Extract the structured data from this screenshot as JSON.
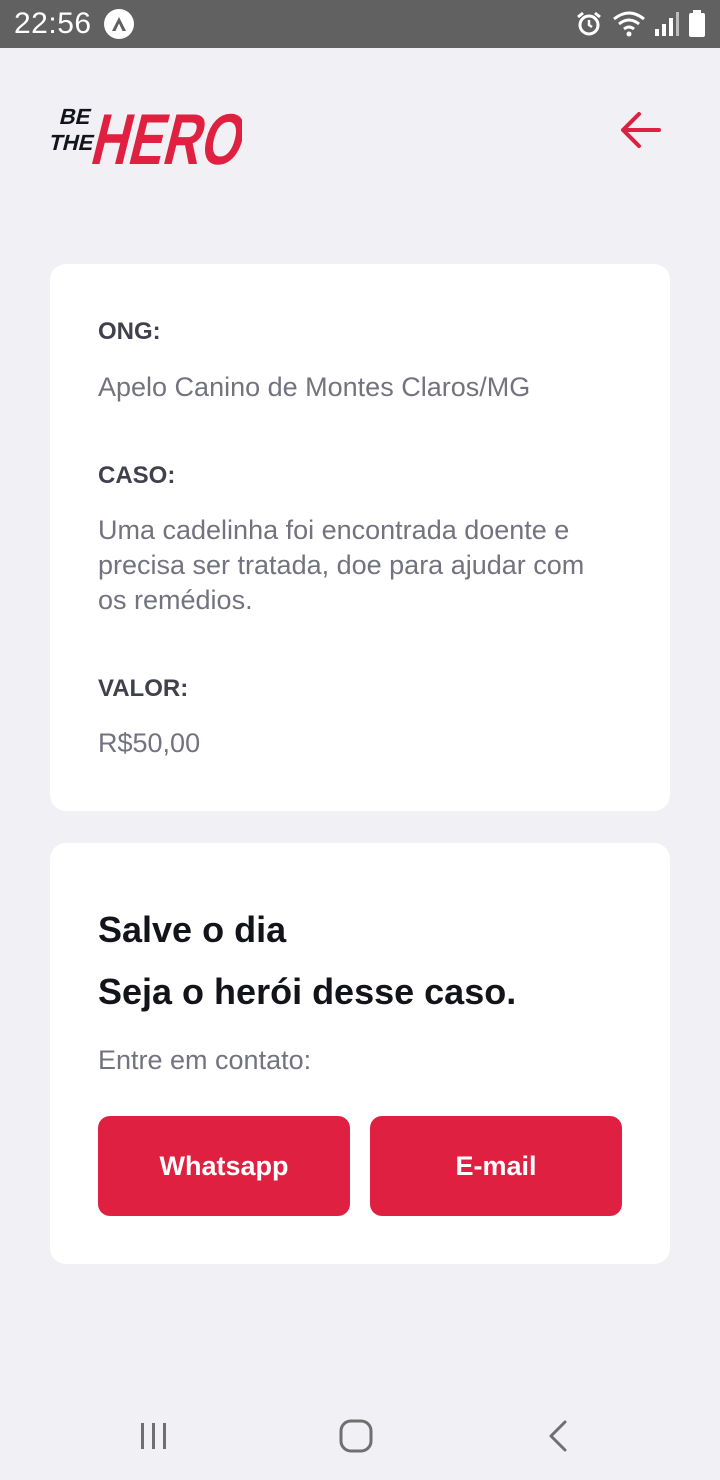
{
  "status_bar": {
    "time": "22:56",
    "icons": [
      "app-notification-icon",
      "alarm-icon",
      "wifi-icon",
      "signal-icon",
      "battery-icon"
    ]
  },
  "header": {
    "logo_text_small": "BE THE",
    "logo_text_big": "HERO",
    "back_icon": "arrow-left-icon"
  },
  "incident": {
    "ong_label": "ONG:",
    "ong_value": "Apelo Canino de Montes Claros/MG",
    "case_label": "CASO:",
    "case_value": "Uma cadelinha foi encontrada doente e precisa ser tratada, doe para ajudar com os remédios.",
    "value_label": "VALOR:",
    "value_value": "R$50,00"
  },
  "contact": {
    "title_line1": "Salve o dia",
    "title_line2": "Seja o herói desse caso.",
    "description": "Entre em contato:",
    "whatsapp_label": "Whatsapp",
    "email_label": "E-mail"
  },
  "nav_bar": {
    "items": [
      "recent-apps-icon",
      "home-icon",
      "back-icon"
    ]
  },
  "colors": {
    "accent": "#e02041",
    "background": "#f0f0f5",
    "label": "#41414d",
    "text": "#737380",
    "title": "#13131a"
  }
}
